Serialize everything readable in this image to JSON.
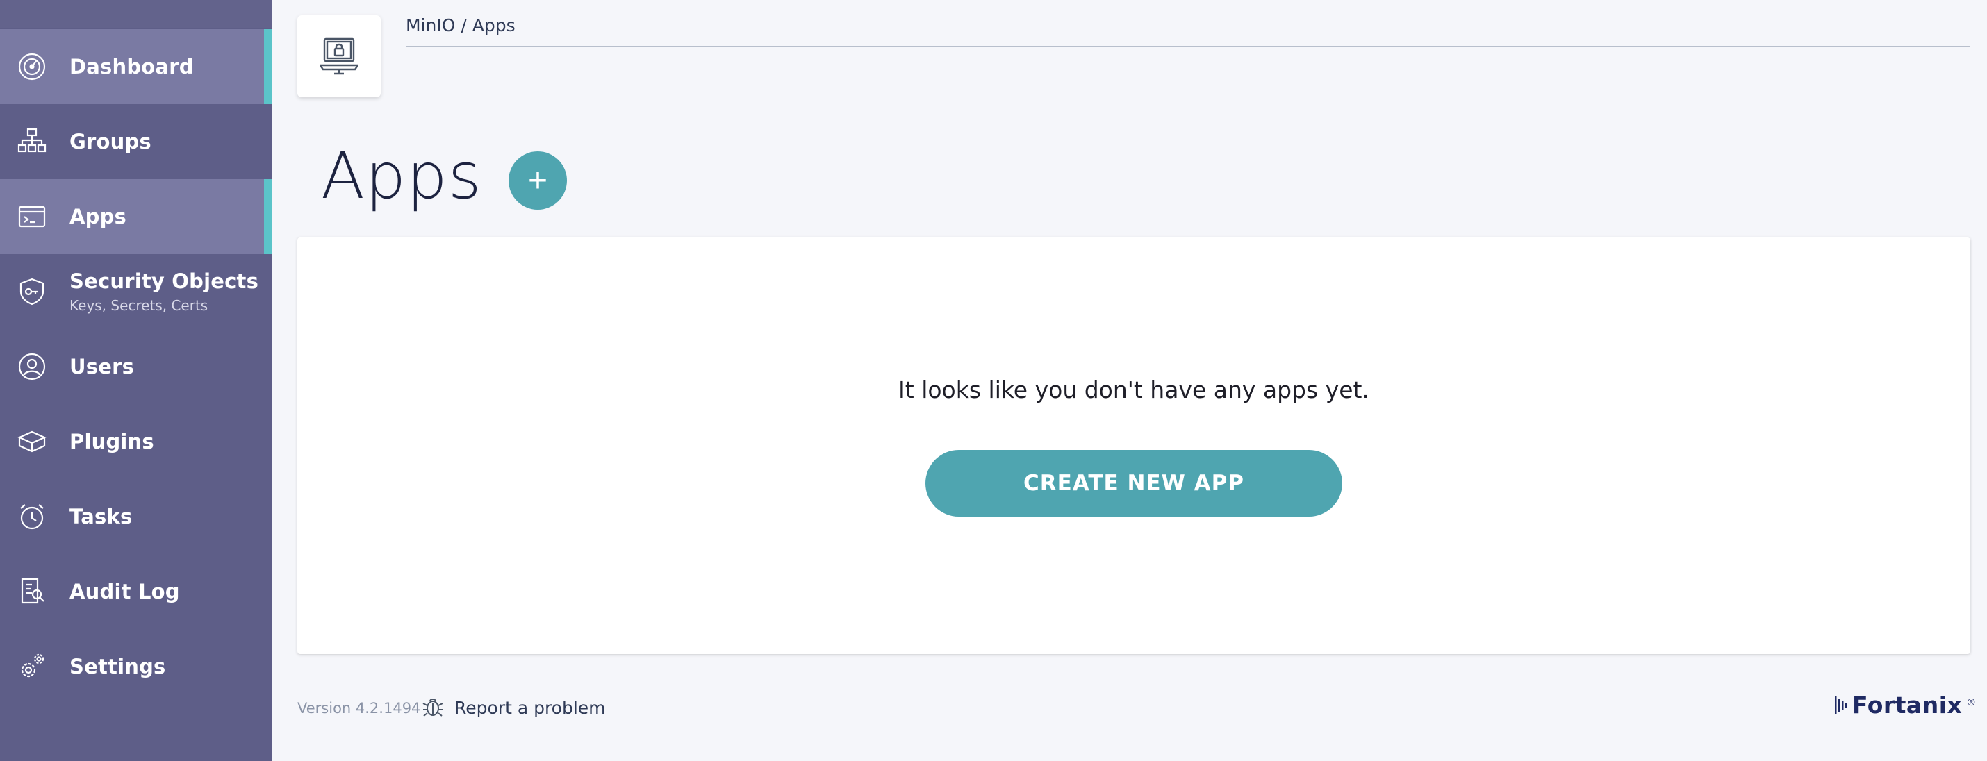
{
  "sidebar": {
    "items": [
      {
        "label": "Dashboard",
        "icon": "dashboard-gauge-icon",
        "active": true
      },
      {
        "label": "Groups",
        "icon": "groups-hierarchy-icon",
        "active": false
      },
      {
        "label": "Apps",
        "icon": "apps-window-icon",
        "active": true
      },
      {
        "label": "Security Objects",
        "sublabel": "Keys, Secrets, Certs",
        "icon": "security-objects-shield-icon",
        "active": false
      },
      {
        "label": "Users",
        "icon": "users-person-icon",
        "active": false
      },
      {
        "label": "Plugins",
        "icon": "plugins-box-icon",
        "active": false
      },
      {
        "label": "Tasks",
        "icon": "tasks-alarm-clock-icon",
        "active": false
      },
      {
        "label": "Audit Log",
        "icon": "audit-log-document-icon",
        "active": false
      },
      {
        "label": "Settings",
        "icon": "settings-gears-icon",
        "active": false
      }
    ]
  },
  "header": {
    "breadcrumb": "MinIO / Apps",
    "icon": "laptop-lock-icon"
  },
  "main": {
    "title": "Apps",
    "add_label": "+",
    "empty_message": "It looks like you don't have any apps yet.",
    "create_label": "CREATE NEW APP"
  },
  "footer": {
    "version": "Version 4.2.1494",
    "report_label": "Report a problem",
    "report_icon": "bug-icon",
    "brand": "Fortanix",
    "brand_mark": "®"
  },
  "colors": {
    "sidebar": "#5e5e88",
    "sidebar_active": "#7a7aa3",
    "active_indicator": "#5bc4c9",
    "accent": "#4fa5b0",
    "background": "#f5f6fa",
    "brand": "#1f2a63"
  }
}
